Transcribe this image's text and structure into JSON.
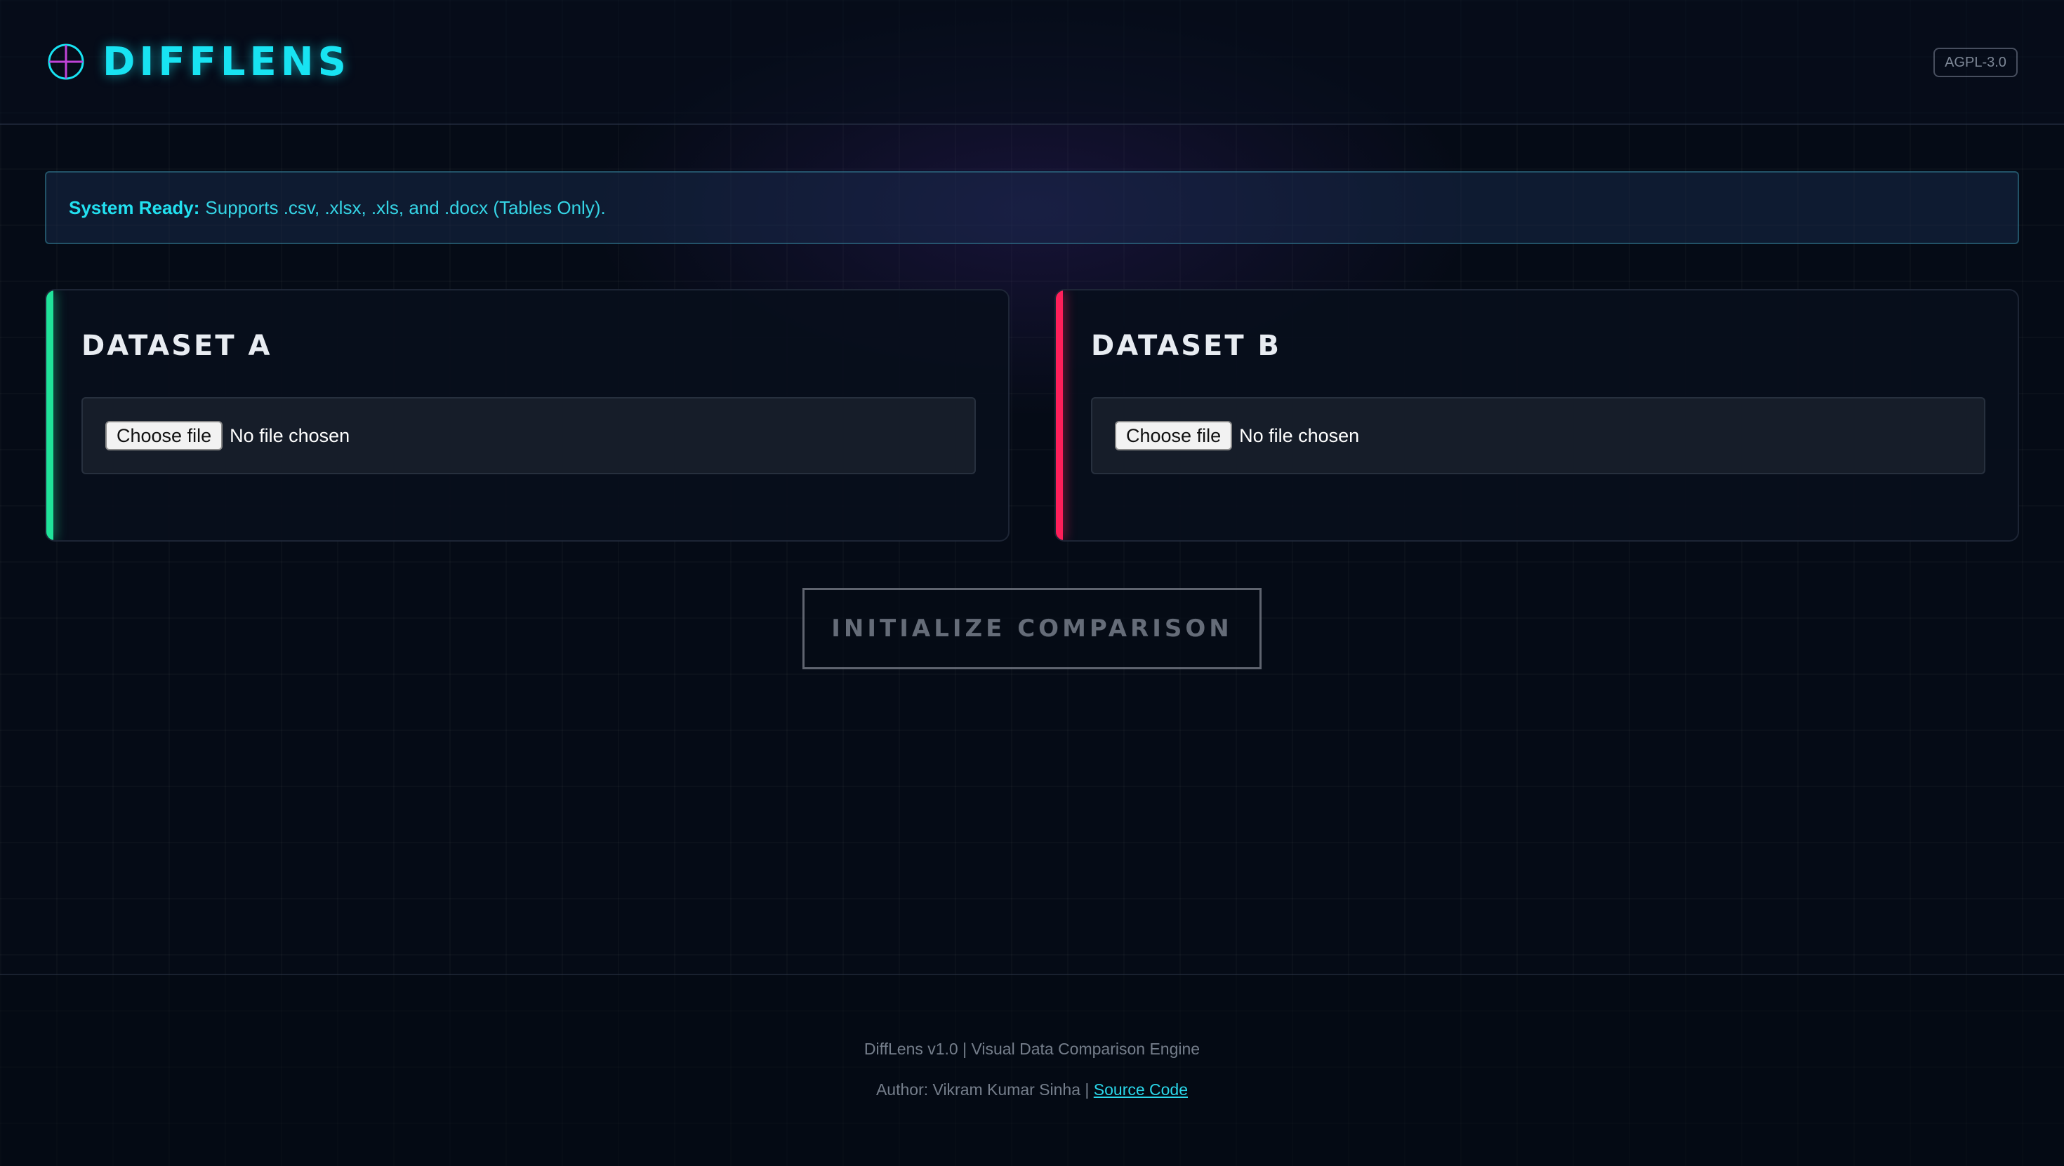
{
  "header": {
    "app_name": "DIFFLENS",
    "logo_icon": "crosshair-icon",
    "license": "AGPL-3.0"
  },
  "banner": {
    "strong": "System Ready:",
    "text": "Supports .csv, .xlsx, .xls, and .docx (Tables Only)."
  },
  "datasets": [
    {
      "title": "DATASET A",
      "accent_color": "#20e39a",
      "choose_label": "Choose file",
      "status": "No file chosen"
    },
    {
      "title": "DATASET B",
      "accent_color": "#ff1f5a",
      "choose_label": "Choose file",
      "status": "No file chosen"
    }
  ],
  "compare_button": "INITIALIZE COMPARISON",
  "footer": {
    "line1": "DiffLens v1.0 | Visual Data Comparison Engine",
    "author": "Author: Vikram Kumar Sinha |",
    "source_link": "Source Code"
  },
  "colors": {
    "accent": "#18e3f2",
    "background": "#050b16"
  }
}
